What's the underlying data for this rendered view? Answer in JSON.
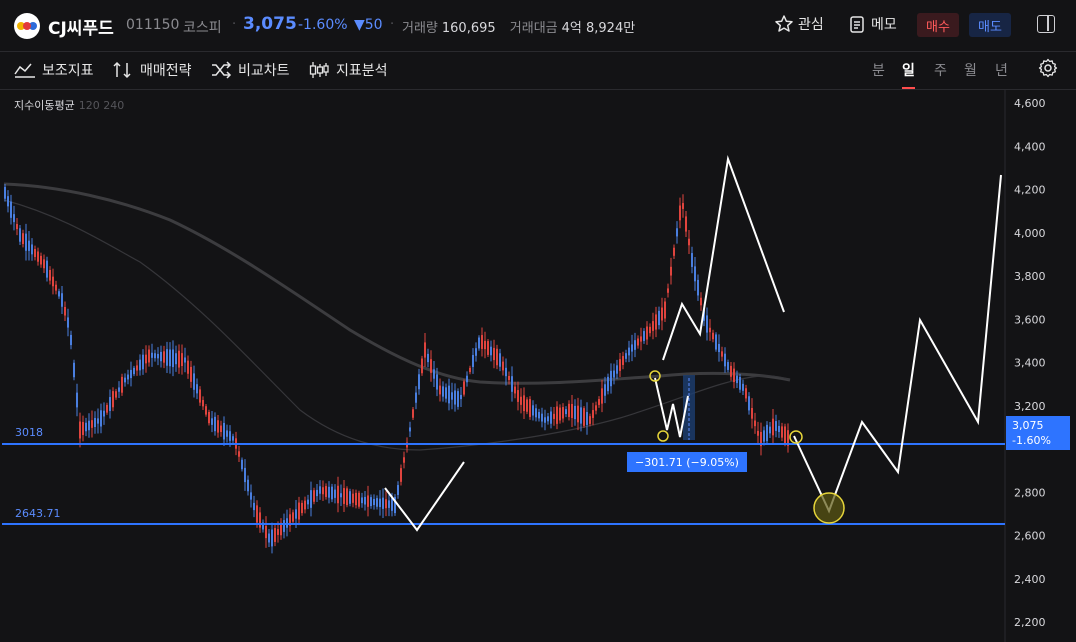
{
  "stock": {
    "name": "CJ씨푸드",
    "code": "011150",
    "market": "코스피",
    "price": "3,075",
    "change_pct": "-1.60%",
    "change_abs": "▼50",
    "volume_label": "거래량",
    "volume": "160,695",
    "amount_label": "거래대금",
    "amount": "4억 8,924만"
  },
  "header_actions": {
    "watch": "관심",
    "memo": "메모",
    "buy": "매수",
    "sell": "매도"
  },
  "toolbar": {
    "indicators": "보조지표",
    "strategy": "매매전략",
    "compare": "비교차트",
    "analysis": "지표분석"
  },
  "periods": [
    "분",
    "일",
    "주",
    "월",
    "년"
  ],
  "active_period": "일",
  "chart": {
    "ma_label": "지수이동평균",
    "ma_params": "120 240",
    "y_ticks": [
      "4,600",
      "4,400",
      "4,200",
      "4,000",
      "3,800",
      "3,600",
      "3,400",
      "3,200",
      "2,800",
      "2,600",
      "2,400",
      "2,200"
    ],
    "level_high": "3018",
    "level_low": "2643.71",
    "current_price": "3,075",
    "current_pct": "-1.60%",
    "measure": "−301.71 (−9.05%)",
    "colors": {
      "up": "#e0443e",
      "down": "#4a7fe0",
      "level": "#2e74ff",
      "annotation": "#ffffff",
      "marker": "#e6d53a"
    }
  },
  "chart_data": {
    "type": "candlestick",
    "ylim": [
      2200,
      4600
    ],
    "horizontal_levels": [
      3018,
      2643.71
    ],
    "last_close": 3075
  }
}
